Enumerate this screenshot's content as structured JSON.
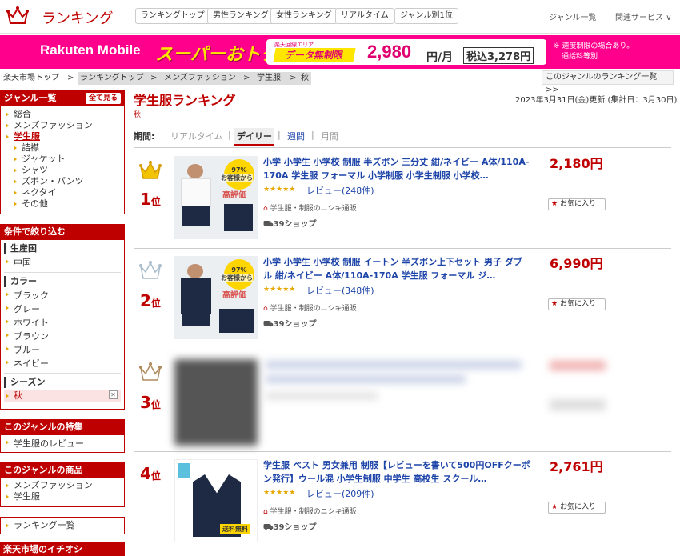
{
  "header": {
    "brand": "ランキング",
    "nav": [
      "ランキングトップ",
      "男性ランキング",
      "女性ランキング",
      "リアルタイム",
      "ジャンル別1位"
    ],
    "genre_list": "ジャンル一覧",
    "related": "関連サービス"
  },
  "banner": {
    "rakuten_mobile": "Rakuten Mobile",
    "super": "スーパーおトク",
    "area_note": "楽天回線エリア",
    "unlimited": "データ無制限",
    "price": "2,980",
    "per_month": "円/月",
    "tax": "税込3,278円",
    "note1": "※ 速度制限の場合あり。",
    "note2": "通話料等別"
  },
  "breadcrumb": {
    "items": [
      "楽天市場トップ",
      ">",
      "ランキングトップ",
      ">",
      "メンズファッション",
      ">",
      "学生服",
      ">",
      "秋"
    ],
    "right_link": "このジャンルのランキング一覧 >>"
  },
  "sidebar": {
    "genre_head": "ジャンル一覧",
    "see_all": "全て見る",
    "genres": [
      "総合",
      "メンズファッション",
      "学生服"
    ],
    "sub_genres": [
      "詰襟",
      "ジャケット",
      "シャツ",
      "ズボン・パンツ",
      "ネクタイ",
      "その他"
    ],
    "filter_head": "条件で絞り込む",
    "origin_head": "生産国",
    "origin": [
      "中国"
    ],
    "color_head": "カラー",
    "colors": [
      "ブラック",
      "グレー",
      "ホワイト",
      "ブラウン",
      "ブルー",
      "ネイビー"
    ],
    "season_head": "シーズン",
    "season_selected": "秋",
    "feature_head": "このジャンルの特集",
    "features": [
      "学生服のレビュー"
    ],
    "products_head": "このジャンルの商品",
    "products": [
      "メンズファッション",
      "学生服"
    ],
    "ranking_list": "ランキング一覧",
    "pickup_head": "楽天市場のイチオシ"
  },
  "main": {
    "title": "学生服ランキング",
    "subtitle": "秋",
    "updated": "2023年3月31日(金)更新 (集計日：3月30日)",
    "period_label": "期間:",
    "periods": [
      "リアルタイム",
      "|",
      "デイリー",
      "|",
      "週間",
      "|",
      "月間"
    ]
  },
  "items": [
    {
      "rank": "1",
      "rank_suffix": "位",
      "name": "小学 小学生 小学校 制服 半ズボン 三分丈 紺/ネイビー A体/110A-170A 学生服 フォーマル 小学制服 小学生制服 小学校…",
      "price": "2,180円",
      "stars": "★★★★★",
      "review": "レビュー(248件)",
      "shop": "学生服・制服のニシキ通販",
      "shipping": "39ショップ",
      "fav": "お気に入り",
      "img_text1": "97%",
      "img_text2": "以上の",
      "img_text3": "お客様から",
      "img_text4": "高評価"
    },
    {
      "rank": "2",
      "rank_suffix": "位",
      "name": "小学 小学生 小学校 制服 イートン 半ズボン上下セット 男子 ダブル 紺/ネイビー A体/110A-170A 学生服 フォーマル ジ…",
      "price": "6,990円",
      "stars": "★★★★★",
      "review": "レビュー(348件)",
      "shop": "学生服・制服のニシキ通販",
      "shipping": "39ショップ",
      "fav": "お気に入り",
      "img_text1": "97%",
      "img_text2": "以上の",
      "img_text3": "お客様から",
      "img_text4": "高評価"
    },
    {
      "rank": "3",
      "rank_suffix": "位"
    },
    {
      "rank": "4",
      "rank_suffix": "位",
      "name": "学生服 ベスト 男女兼用 制服【レビューを書いて500円OFFクーポン発行】ウール混 小学生制服 中学生 高校生 スクール…",
      "price": "2,761円",
      "stars": "★★★★★",
      "review": "レビュー(209件)",
      "shop": "学生服・制服のニシキ通販",
      "shipping": "39ショップ",
      "fav": "お気に入り",
      "img_text1": "送料無料"
    }
  ],
  "colors": {
    "accent": "#bf0000",
    "link": "#1d44a8",
    "banner": "#ff008c",
    "gold": "#e6a800"
  }
}
